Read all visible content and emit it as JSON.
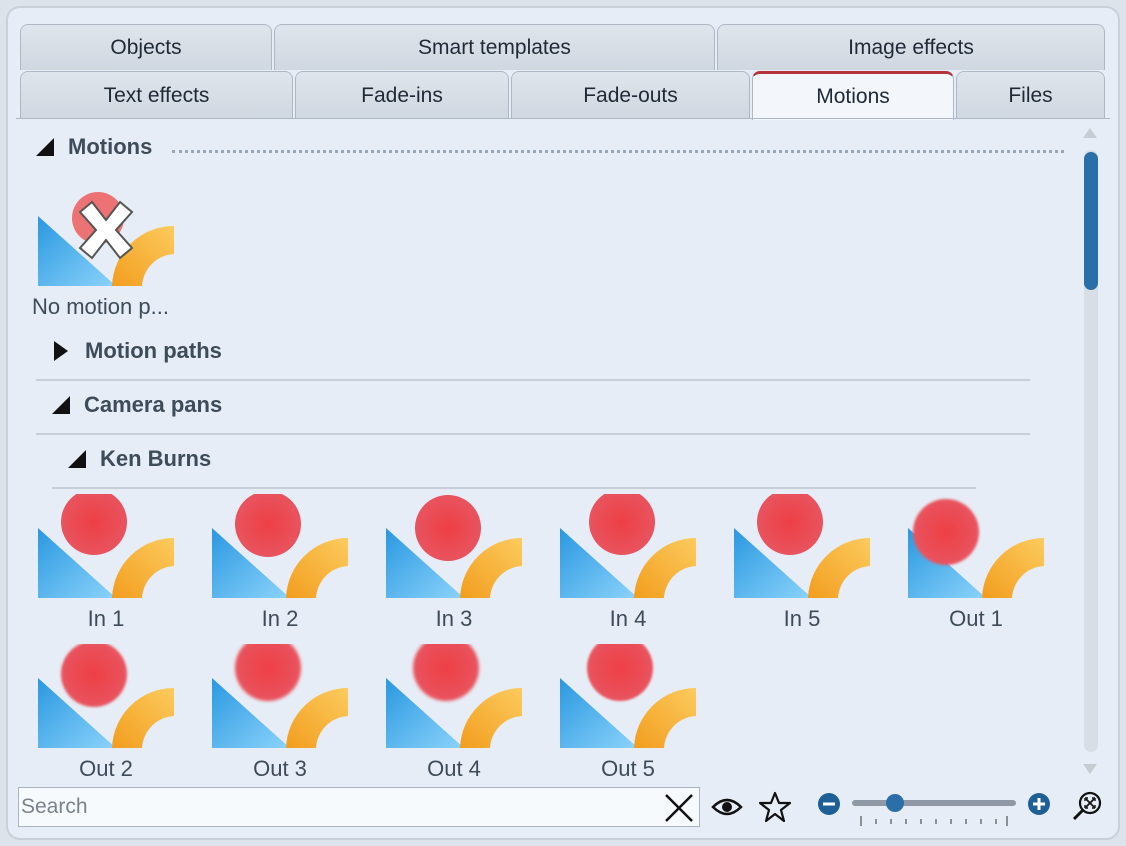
{
  "tabs_row1": [
    "Objects",
    "Smart templates",
    "Image effects"
  ],
  "tabs_row2": [
    "Text effects",
    "Fade-ins",
    "Fade-outs",
    "Motions",
    "Files"
  ],
  "active_tab": "Motions",
  "sections": {
    "motions": "Motions",
    "no_motion": "No motion p...",
    "motion_paths": "Motion paths",
    "camera_pans": "Camera pans",
    "ken_burns": "Ken Burns"
  },
  "ken_burns_items": [
    "In 1",
    "In 2",
    "In 3",
    "In 4",
    "In 5",
    "Out 1",
    "Out 2",
    "Out 3",
    "Out 4",
    "Out 5"
  ],
  "search": {
    "placeholder": "Search",
    "value": ""
  },
  "icons": [
    "collapse-triangle-icon",
    "expand-triangle-icon",
    "clear-x-icon",
    "eye-icon",
    "star-icon",
    "zoom-out-icon",
    "zoom-in-icon",
    "zoom-fit-icon"
  ],
  "colors": {
    "accent": "#2b6fa8",
    "active_tab_border": "#b3353b",
    "circle_red": "#e9474e",
    "triangle_blue": "#3ba7e8",
    "arc_orange": "#f5a623"
  },
  "zoom_level_fraction": 0.26
}
